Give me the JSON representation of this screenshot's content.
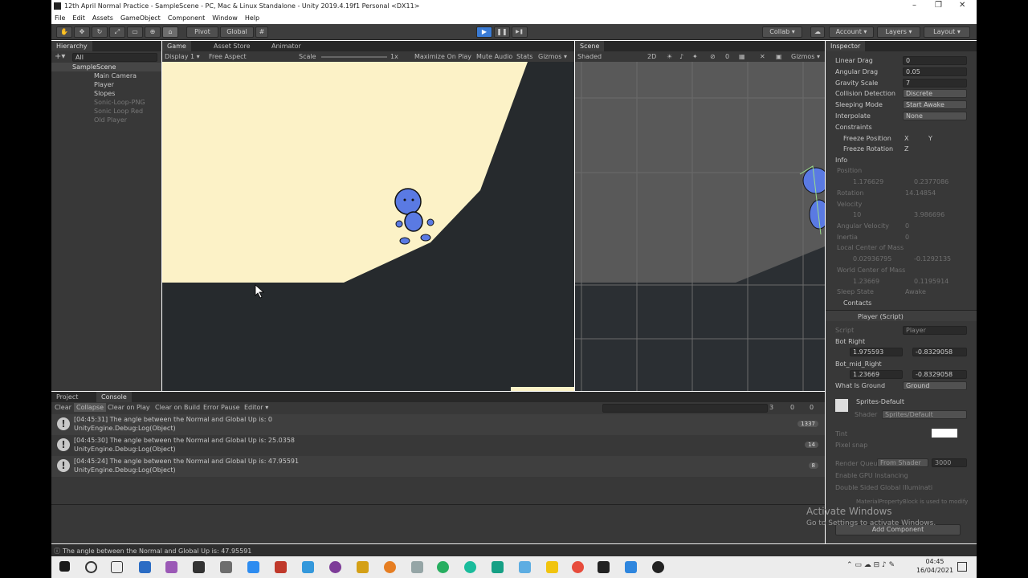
{
  "window": {
    "title": "12th April Normal Practice - SampleScene - PC, Mac & Linux Standalone - Unity 2019.4.19f1 Personal <DX11>",
    "minimize": "–",
    "maximize": "❐",
    "close": "✕"
  },
  "menu": [
    "File",
    "Edit",
    "Assets",
    "GameObject",
    "Component",
    "Window",
    "Help"
  ],
  "toolbar": {
    "pivot": "Pivot",
    "global": "Global",
    "collab": "Collab ▾",
    "account": "Account ▾",
    "layers": "Layers ▾",
    "layout": "Layout ▾",
    "play": "▶",
    "pause": "❚❚",
    "step": "▶❚"
  },
  "hierarchy": {
    "tab": "Hierarchy",
    "search": "All",
    "scene": "SampleScene",
    "items": [
      "Main Camera",
      "Player",
      "Slopes",
      "Sonic-Loop-PNG",
      "Sonic Loop Red",
      "Old Player"
    ]
  },
  "game": {
    "tabs": [
      "Game",
      "Asset Store",
      "Animator"
    ],
    "display": "Display 1 ▾",
    "aspect": "Free Aspect",
    "scale_label": "Scale",
    "scale_value": "1x",
    "maximize": "Maximize On Play",
    "mute": "Mute Audio",
    "stats": "Stats",
    "gizmos": "Gizmos ▾"
  },
  "scene": {
    "tab": "Scene",
    "shading": "Shaded",
    "mode2d": "2D",
    "gizmos": "Gizmos ▾",
    "hidden_count": "0"
  },
  "inspector": {
    "tab": "Inspector",
    "rows": [
      {
        "label": "Linear Drag",
        "value": "0"
      },
      {
        "label": "Angular Drag",
        "value": "0.05"
      },
      {
        "label": "Gravity Scale",
        "value": "7"
      }
    ],
    "collision": {
      "label": "Collision Detection",
      "value": "Discrete"
    },
    "sleeping": {
      "label": "Sleeping Mode",
      "value": "Start Awake"
    },
    "interpolate": {
      "label": "Interpolate",
      "value": "None"
    },
    "constraints": "Constraints",
    "freeze_pos": {
      "label": "Freeze Position",
      "x": "X",
      "y": "Y"
    },
    "freeze_rot": {
      "label": "Freeze Rotation",
      "z": "Z"
    },
    "info": "Info",
    "position": {
      "label": "Position",
      "x": "1.176629",
      "y": "0.2377086"
    },
    "rotation": {
      "label": "Rotation",
      "value": "14.14854"
    },
    "velocity": {
      "label": "Velocity",
      "x": "10",
      "y": "3.986696"
    },
    "ang_vel": {
      "label": "Angular Velocity",
      "value": "0"
    },
    "inertia": {
      "label": "Inertia",
      "value": "0"
    },
    "local_com": {
      "label": "Local Center of Mass",
      "x": "0.02936795",
      "y": "-0.1292135"
    },
    "world_com": {
      "label": "World Center of Mass",
      "x": "1.23669",
      "y": "0.1195914"
    },
    "sleep_state": {
      "label": "Sleep State",
      "value": "Awake"
    },
    "contacts": "Contacts",
    "script_title": "Player (Script)",
    "script": {
      "label": "Script",
      "value": "Player"
    },
    "bot_right": {
      "label": "Bot Right",
      "x": "1.975593",
      "y": "-0.8329058"
    },
    "bot_mid_right": {
      "label": "Bot_mid_Right",
      "x": "1.23669",
      "y": "-0.8329058"
    },
    "ground": {
      "label": "What Is Ground",
      "value": "Ground"
    },
    "material": "Sprites-Default",
    "shader": {
      "label": "Shader",
      "value": "Sprites/Default"
    },
    "tint": "Tint",
    "pixel_snap": "Pixel snap",
    "render_queue": {
      "label": "Render Queu",
      "mode": "From Shader",
      "value": "3000"
    },
    "gpu": "Enable GPU Instancing",
    "double_sided": "Double Sided Global Illuminati",
    "note": "MaterialPropertyBlock is used to modify",
    "add_component": "Add Component"
  },
  "project_tabs": [
    "Project",
    "Console"
  ],
  "console": {
    "buttons": [
      "Clear",
      "Collapse",
      "Clear on Play",
      "Clear on Build",
      "Error Pause",
      "Editor ▾"
    ],
    "counts": {
      "info": "3",
      "warn": "0",
      "error": "0"
    },
    "logs": [
      {
        "line1": "[04:45:31] The angle between the Normal and Global Up is: 0",
        "line2": "UnityEngine.Debug:Log(Object)",
        "count": "1337"
      },
      {
        "line1": "[04:45:30] The angle between the Normal and Global Up is: 25.0358",
        "line2": "UnityEngine.Debug:Log(Object)",
        "count": "14"
      },
      {
        "line1": "[04:45:24] The angle between the Normal and Global Up is: 47.95591",
        "line2": "UnityEngine.Debug:Log(Object)",
        "count": "8"
      }
    ]
  },
  "statusbar": "The angle between the Normal and Global Up is: 47.95591",
  "watermark": {
    "line1": "Activate Windows",
    "line2": "Go to Settings to activate Windows."
  },
  "clock": {
    "time": "04:45",
    "date": "16/04/2021"
  },
  "colors": {
    "sky": "#fcf2c7",
    "ground": "#262a2d",
    "player": "#5a7ae3",
    "play_accent": "#3a7bd5"
  }
}
